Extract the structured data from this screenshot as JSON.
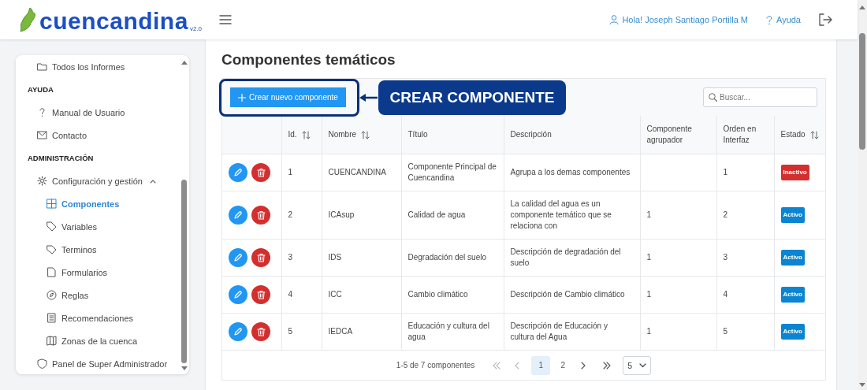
{
  "header": {
    "logo": "cuencandina",
    "version": "v2.0",
    "user": "Hola! Joseph Santiago Portilla M",
    "help": "Ayuda"
  },
  "sidebar": {
    "items": [
      {
        "kind": "link",
        "label": "Todos los Informes",
        "selected": false
      },
      {
        "kind": "heading",
        "label": "AYUDA"
      },
      {
        "kind": "link",
        "label": "Manual de Usuario",
        "selected": false
      },
      {
        "kind": "link",
        "label": "Contacto",
        "selected": false
      },
      {
        "kind": "heading",
        "label": "ADMINISTRACIÓN"
      },
      {
        "kind": "group",
        "label": "Configuración y gestión",
        "expanded": true,
        "children": [
          {
            "label": "Componentes",
            "selected": true
          },
          {
            "label": "Variables",
            "selected": false
          },
          {
            "label": "Terminos",
            "selected": false
          },
          {
            "label": "Formularios",
            "selected": false
          },
          {
            "label": "Reglas",
            "selected": false
          },
          {
            "label": "Recomendaciones",
            "selected": false
          },
          {
            "label": "Zonas de la cuenca",
            "selected": false
          }
        ]
      },
      {
        "kind": "link",
        "label": "Panel de Super Administrador",
        "selected": false
      }
    ]
  },
  "page": {
    "title": "Componentes temáticos"
  },
  "toolbar": {
    "create_button": "Crear nuevo componente",
    "search": {
      "placeholder": "Buscar..."
    }
  },
  "callout": {
    "label": "CREAR COMPONENTE"
  },
  "table": {
    "columns": [
      {
        "label": "Id.",
        "sortable": true
      },
      {
        "label": "Nombre",
        "sortable": true
      },
      {
        "label": "Título",
        "sortable": false
      },
      {
        "label": "Descripción",
        "sortable": false
      },
      {
        "label": "Componente agrupador",
        "sortable": false
      },
      {
        "label": "Orden en Interfaz",
        "sortable": false
      },
      {
        "label": "Estado",
        "sortable": true
      }
    ],
    "rows": [
      {
        "id": "1",
        "nombre": "CUENCANDINA",
        "titulo": "Componente Principal de Cuencandina",
        "descripcion": "Agrupa a los demas componentes",
        "orden": "1",
        "estado": {
          "label": "Inactivo",
          "kind": "inactive"
        }
      },
      {
        "id": "2",
        "nombre": "ICAsup",
        "titulo": "Calidad de agua",
        "descripcion": "La calidad del agua es un componente temático que se relaciona con",
        "agrupador": "1",
        "orden": "2",
        "estado": {
          "label": "Activo",
          "kind": "active"
        }
      },
      {
        "id": "3",
        "nombre": "IDS",
        "titulo": "Degradación del suelo",
        "descripcion": "Descripción de degradación del suelo",
        "agrupador": "1",
        "orden": "3",
        "estado": {
          "label": "Activo",
          "kind": "active"
        }
      },
      {
        "id": "4",
        "nombre": "ICC",
        "titulo": "Cambio climático",
        "descripcion": "Descripción de Cambio climático",
        "agrupador": "1",
        "orden": "4",
        "estado": {
          "label": "Activo",
          "kind": "active"
        }
      },
      {
        "id": "5",
        "nombre": "IEDCA",
        "titulo": "Educación y cultura del agua",
        "descripcion": "Descripción de Educación y cultura del Agua",
        "agrupador": "1",
        "orden": "5",
        "estado": {
          "label": "Activo",
          "kind": "active"
        }
      }
    ]
  },
  "pagination": {
    "summary": "1-5 de 7 componentes",
    "nav": [
      {
        "kind": "first",
        "disabled": true
      },
      {
        "kind": "prev",
        "disabled": true
      },
      {
        "kind": "next",
        "disabled": false
      },
      {
        "kind": "last",
        "disabled": false
      }
    ],
    "pages": [
      {
        "label": "1",
        "selected": true
      },
      {
        "label": "2",
        "selected": false
      }
    ],
    "page_size": "5"
  }
}
